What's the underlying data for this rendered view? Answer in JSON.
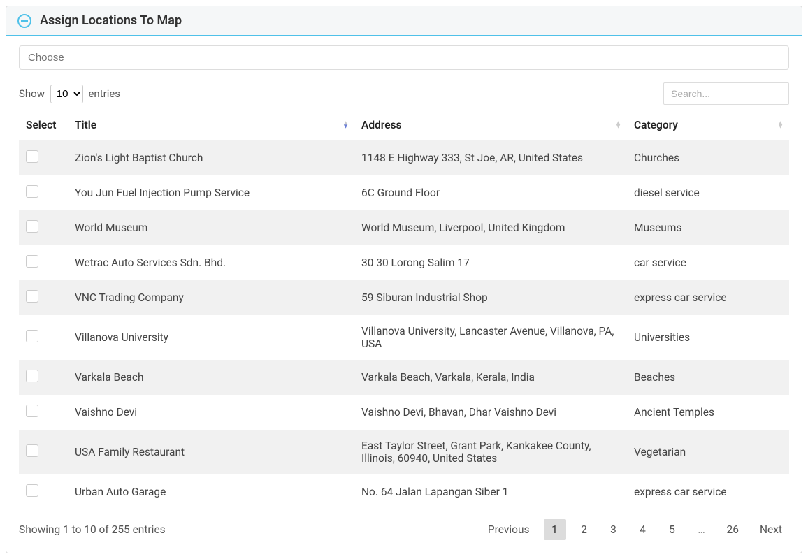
{
  "header": {
    "title": "Assign Locations To Map"
  },
  "choose": {
    "placeholder": "Choose",
    "value": ""
  },
  "entries": {
    "show_label": "Show",
    "entries_label": "entries",
    "selected": "10"
  },
  "search": {
    "placeholder": "Search...",
    "value": ""
  },
  "columns": {
    "select": "Select",
    "title": "Title",
    "address": "Address",
    "category": "Category"
  },
  "rows": [
    {
      "title": "Zion's Light Baptist Church",
      "address": "1148 E Highway 333, St Joe, AR, United States",
      "category": "Churches"
    },
    {
      "title": "You Jun Fuel Injection Pump Service",
      "address": "6C Ground Floor",
      "category": "diesel service"
    },
    {
      "title": "World Museum",
      "address": "World Museum, Liverpool, United Kingdom",
      "category": "Museums"
    },
    {
      "title": "Wetrac Auto Services Sdn. Bhd.",
      "address": "30 30 Lorong Salim 17",
      "category": "car service"
    },
    {
      "title": "VNC Trading Company",
      "address": "59 Siburan Industrial Shop",
      "category": "express car service"
    },
    {
      "title": "Villanova University",
      "address": "Villanova University, Lancaster Avenue, Villanova, PA, USA",
      "category": "Universities"
    },
    {
      "title": "Varkala Beach",
      "address": "Varkala Beach, Varkala, Kerala, India",
      "category": "Beaches"
    },
    {
      "title": "Vaishno Devi",
      "address": "Vaishno Devi, Bhavan, Dhar Vaishno Devi",
      "category": "Ancient Temples"
    },
    {
      "title": "USA Family Restaurant",
      "address": "East Taylor Street, Grant Park, Kankakee County, Illinois, 60940, United States",
      "category": "Vegetarian"
    },
    {
      "title": "Urban Auto Garage",
      "address": "No. 64 Jalan Lapangan Siber 1",
      "category": "express car service"
    }
  ],
  "footer": {
    "info": "Showing 1 to 10 of 255 entries",
    "previous": "Previous",
    "next": "Next",
    "pages": [
      "1",
      "2",
      "3",
      "4",
      "5",
      "…",
      "26"
    ],
    "current": "1"
  }
}
